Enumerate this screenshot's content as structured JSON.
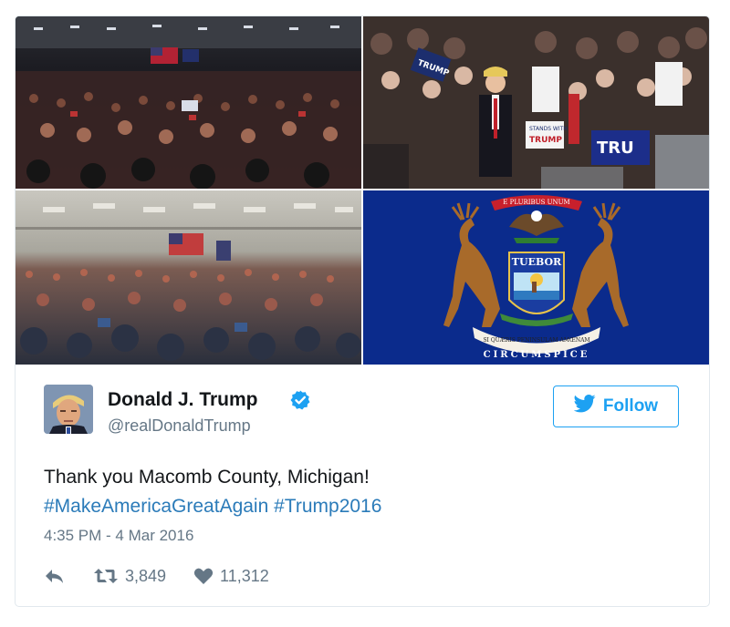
{
  "tweet": {
    "author_name": "Donald J. Trump",
    "handle": "@realDonaldTrump",
    "follow_label": "Follow",
    "text_line1": "Thank you Macomb County, Michigan!",
    "hashtag1": "#MakeAmericaGreatAgain",
    "hashtag2": "#Trump2016",
    "timestamp": "4:35 PM - 4 Mar 2016",
    "retweets": "3,849",
    "likes": "11,312"
  },
  "media": {
    "sign_trump": "TRUMP",
    "sign_stands": "STANDS WITH",
    "sign_tru": "TRU",
    "seal_motto_top": "E PLURIBUS UNUM",
    "seal_shield": "TUEBOR",
    "seal_motto_bottom": "SI QUÆRIS PENINSULAM AMŒNAM",
    "seal_circumspice": "CIRCUMSPICE"
  },
  "colors": {
    "accent": "#1da1f2",
    "hashtag": "#2b7bb9",
    "muted": "#657786",
    "flag_blue": "#0a2a8a"
  },
  "icons": [
    "verified-badge-icon",
    "twitter-bird-icon",
    "reply-icon",
    "retweet-icon",
    "like-heart-icon"
  ]
}
